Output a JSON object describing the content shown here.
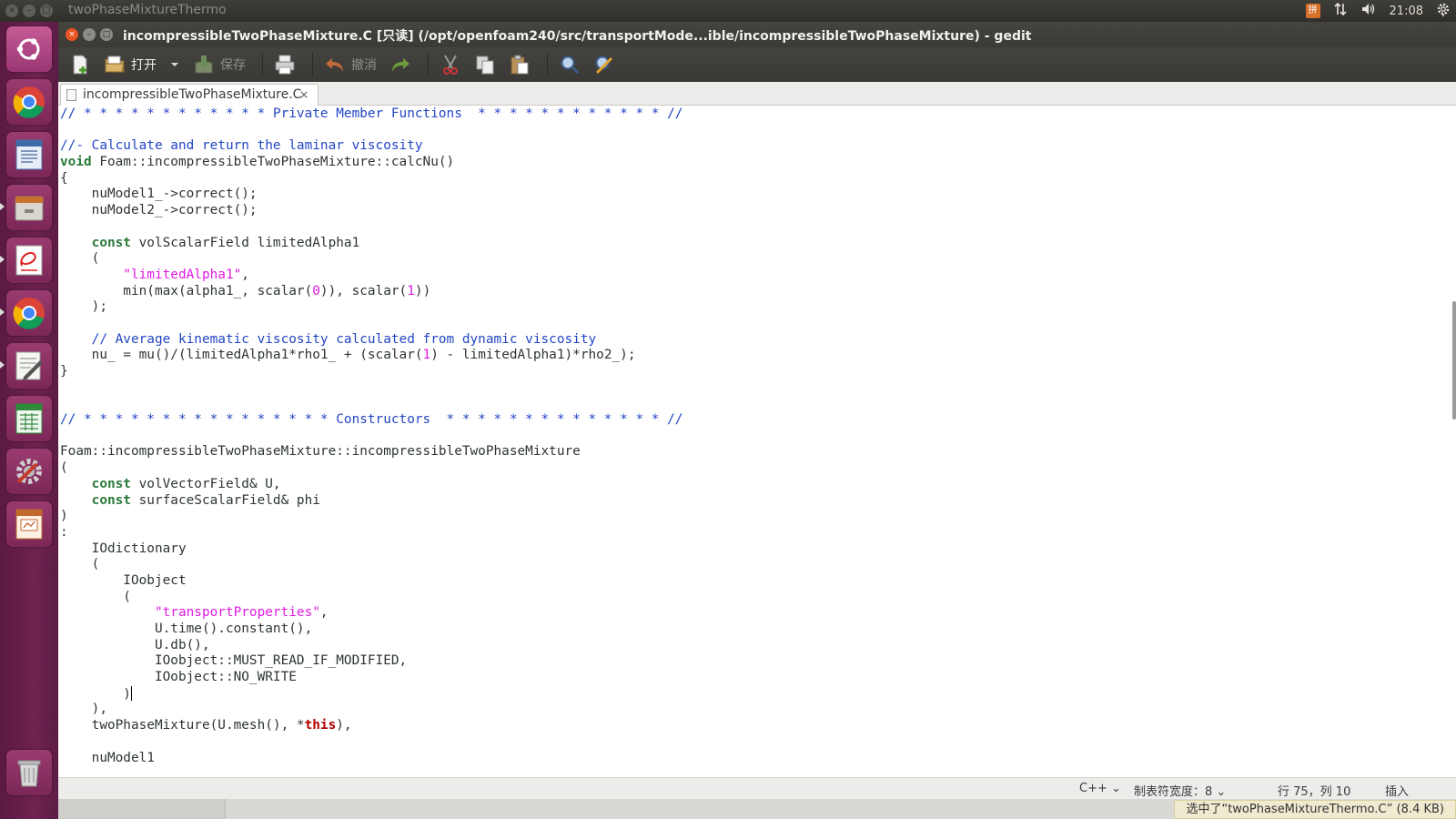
{
  "topbar": {
    "app_title": "twoPhaseMixtureThermo",
    "time": "21:08",
    "keyboard_label": "拼"
  },
  "gedit": {
    "window_title": "incompressibleTwoPhaseMixture.C [只读] (/opt/openfoam240/src/transportMode...ible/incompressibleTwoPhaseMixture) - gedit",
    "toolbar": {
      "open_label": "打开",
      "save_label": "保存",
      "undo_label": "撤消"
    },
    "tab": {
      "label": "incompressibleTwoPhaseMixture.C",
      "close": "×"
    },
    "code_lines": [
      [
        [
          "c",
          "// * * * * * * * * * * * * Private Member Functions  * * * * * * * * * * * * //"
        ]
      ],
      [
        [
          "p",
          ""
        ]
      ],
      [
        [
          "c",
          "//- Calculate and return the laminar viscosity"
        ]
      ],
      [
        [
          "k",
          "void"
        ],
        [
          "p",
          " Foam::incompressibleTwoPhaseMixture::calcNu()"
        ]
      ],
      [
        [
          "p",
          "{"
        ]
      ],
      [
        [
          "p",
          "    nuModel1_->correct();"
        ]
      ],
      [
        [
          "p",
          "    nuModel2_->correct();"
        ]
      ],
      [
        [
          "p",
          ""
        ]
      ],
      [
        [
          "p",
          "    "
        ],
        [
          "k",
          "const"
        ],
        [
          "p",
          " volScalarField limitedAlpha1"
        ]
      ],
      [
        [
          "p",
          "    ("
        ]
      ],
      [
        [
          "p",
          "        "
        ],
        [
          "s",
          "\"limitedAlpha1\""
        ],
        [
          "p",
          ","
        ]
      ],
      [
        [
          "p",
          "        min(max(alpha1_, scalar("
        ],
        [
          "n",
          "0"
        ],
        [
          "p",
          ")), scalar("
        ],
        [
          "n",
          "1"
        ],
        [
          "p",
          "))"
        ]
      ],
      [
        [
          "p",
          "    );"
        ]
      ],
      [
        [
          "p",
          ""
        ]
      ],
      [
        [
          "p",
          "    "
        ],
        [
          "c",
          "// Average kinematic viscosity calculated from dynamic viscosity"
        ]
      ],
      [
        [
          "p",
          "    nu_ = mu()/(limitedAlpha1*rho1_ + (scalar("
        ],
        [
          "n",
          "1"
        ],
        [
          "p",
          ") - limitedAlpha1)*rho2_);"
        ]
      ],
      [
        [
          "p",
          "}"
        ]
      ],
      [
        [
          "p",
          ""
        ]
      ],
      [
        [
          "p",
          ""
        ]
      ],
      [
        [
          "c",
          "// * * * * * * * * * * * * * * * * Constructors  * * * * * * * * * * * * * * //"
        ]
      ],
      [
        [
          "p",
          ""
        ]
      ],
      [
        [
          "p",
          "Foam::incompressibleTwoPhaseMixture::incompressibleTwoPhaseMixture"
        ]
      ],
      [
        [
          "p",
          "("
        ]
      ],
      [
        [
          "p",
          "    "
        ],
        [
          "k",
          "const"
        ],
        [
          "p",
          " volVectorField& U,"
        ]
      ],
      [
        [
          "p",
          "    "
        ],
        [
          "k",
          "const"
        ],
        [
          "p",
          " surfaceScalarField& phi"
        ]
      ],
      [
        [
          "p",
          ")"
        ]
      ],
      [
        [
          "p",
          ":"
        ]
      ],
      [
        [
          "p",
          "    IOdictionary"
        ]
      ],
      [
        [
          "p",
          "    ("
        ]
      ],
      [
        [
          "p",
          "        IOobject"
        ]
      ],
      [
        [
          "p",
          "        ("
        ]
      ],
      [
        [
          "p",
          "            "
        ],
        [
          "s",
          "\"transportProperties\""
        ],
        [
          "p",
          ","
        ]
      ],
      [
        [
          "p",
          "            U.time().constant(),"
        ]
      ],
      [
        [
          "p",
          "            U.db(),"
        ]
      ],
      [
        [
          "p",
          "            IOobject::MUST_READ_IF_MODIFIED,"
        ]
      ],
      [
        [
          "p",
          "            IOobject::NO_WRITE"
        ]
      ],
      [
        [
          "p",
          "        )"
        ],
        [
          "cur",
          ""
        ]
      ],
      [
        [
          "p",
          "    ),"
        ]
      ],
      [
        [
          "p",
          "    twoPhaseMixture(U.mesh(), *"
        ],
        [
          "t",
          "this"
        ],
        [
          "p",
          "),"
        ]
      ],
      [
        [
          "p",
          ""
        ]
      ],
      [
        [
          "p",
          "    nuModel1"
        ]
      ]
    ],
    "status": {
      "language": "C++",
      "tab_width": "制表符宽度：8",
      "position": "行 75，列 10",
      "mode": "插入"
    },
    "notification": "选中了“twoPhaseMixtureThermo.C” (8.4 KB)"
  },
  "launcher": {
    "items": [
      {
        "name": "ubuntu-home-icon",
        "active": false
      },
      {
        "name": "chrome-icon",
        "active": false
      },
      {
        "name": "libreoffice-writer-icon",
        "active": false
      },
      {
        "name": "file-manager-icon",
        "active": true
      },
      {
        "name": "document-viewer-icon",
        "active": true
      },
      {
        "name": "chrome-icon-2",
        "active": true
      },
      {
        "name": "text-editor-icon",
        "active": true
      },
      {
        "name": "libreoffice-calc-icon",
        "active": false
      },
      {
        "name": "system-settings-icon",
        "active": false
      },
      {
        "name": "libreoffice-impress-icon",
        "active": false
      },
      {
        "name": "trash-icon",
        "active": false
      }
    ]
  }
}
